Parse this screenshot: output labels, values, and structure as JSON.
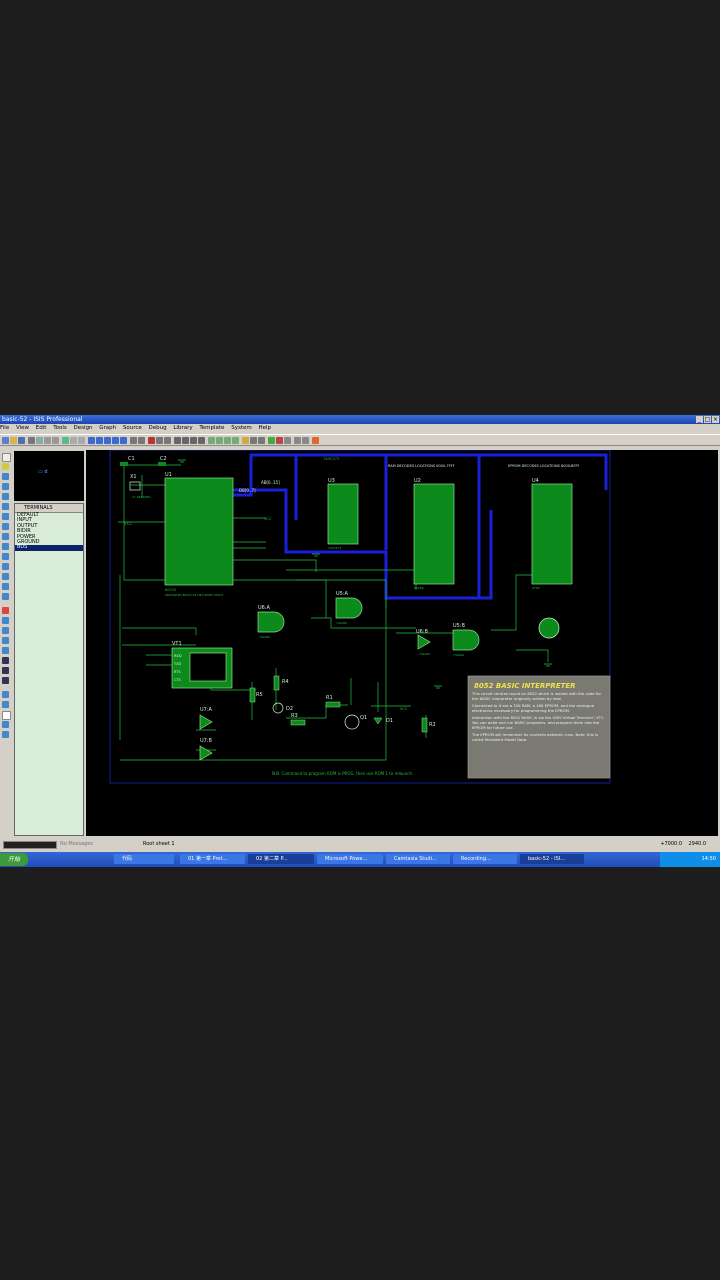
{
  "window": {
    "title": "basic-52 - ISIS Professional"
  },
  "menu": [
    "File",
    "View",
    "Edit",
    "Tools",
    "Design",
    "Graph",
    "Source",
    "Debug",
    "Library",
    "Template",
    "System",
    "Help"
  ],
  "device_panel": {
    "header": "TERMINALS",
    "items": [
      "DEFAULT",
      "INPUT",
      "OUTPUT",
      "BIDIR",
      "POWER",
      "GROUND",
      "BUS"
    ],
    "selected": "BUS"
  },
  "status": {
    "message": "No Messages",
    "sheet": "Root sheet 1",
    "coord_x": "+7000.0",
    "coord_y": "2940.0"
  },
  "taskbar": {
    "start": "开始",
    "buttons": [
      "代码",
      "01 第一章 Prot...",
      "02 第二章 P...",
      "Microsoft Powe...",
      "Camtasia Studi...",
      "Recording...",
      "basic-52 - ISI..."
    ],
    "clock": "14:50"
  },
  "schematic": {
    "caps": [
      "C1",
      "C2"
    ],
    "crystal": "X1",
    "crystal_sub": "11.0592MHz",
    "u1": "U1",
    "u1_sub": "80C52",
    "u1_prog": "PROGRAM=BASIC-52.HEX,PORT=0010",
    "u3": "U3",
    "u3_sub": "74LS373",
    "u2": "U2",
    "u2_sub": "62256",
    "u4": "U4",
    "u4_sub": "2764",
    "ram_note": "RAM DECODES LOCATIONS 0000-7FFF",
    "eprom_note": "EPROM DECODES LOCATIONS 8000-BFFF",
    "latch_note": "74HC573",
    "gates": [
      "U6:A",
      "U5:A",
      "U6:B",
      "U5:B",
      "U7:A",
      "U7:B"
    ],
    "gate_sub": "74LS00",
    "vt": "VT1",
    "vt_pins": [
      "RXD",
      "TXD",
      "RTS",
      "CTS"
    ],
    "resistors": [
      "R1",
      "R2",
      "R3",
      "R4",
      "R5"
    ],
    "diodes": [
      "D1",
      "D2"
    ],
    "transistor": "Q1",
    "vcc": "VCC",
    "bus_ab": "AB[0..15]",
    "bus_db": "DB[0..7]",
    "footer_note": "N.B. Command to program ROM is PROG. then use ROM 1 to relaunch.",
    "info_box": {
      "title": "8052 BASIC INTERPRETER",
      "p1": "This circuit centres round an 8052 which is loaded with the code for the BASIC interpreter originally written by Intel.",
      "p2": "Connected to it are a 32K RAM, a 16K EPROM, and the analogue electronics necessary for programming the EPROM.",
      "p3": "Interaction with the 8052 BASIC is via the VSM 'Virtual Terminal', VT1. You can write and run BASIC programs, and program them into the EPROM for future use.",
      "p4": "The EPROM will remember its contents between runs. Note: this is called Persistent Model Data."
    }
  },
  "colors": {
    "wire": "#1fbf3f",
    "bus": "#1a1fd8",
    "chip": "#0d8a1c",
    "infobox": "#7a7a72",
    "infotitle": "#f2e24a",
    "taskbar": "#2456c8"
  }
}
